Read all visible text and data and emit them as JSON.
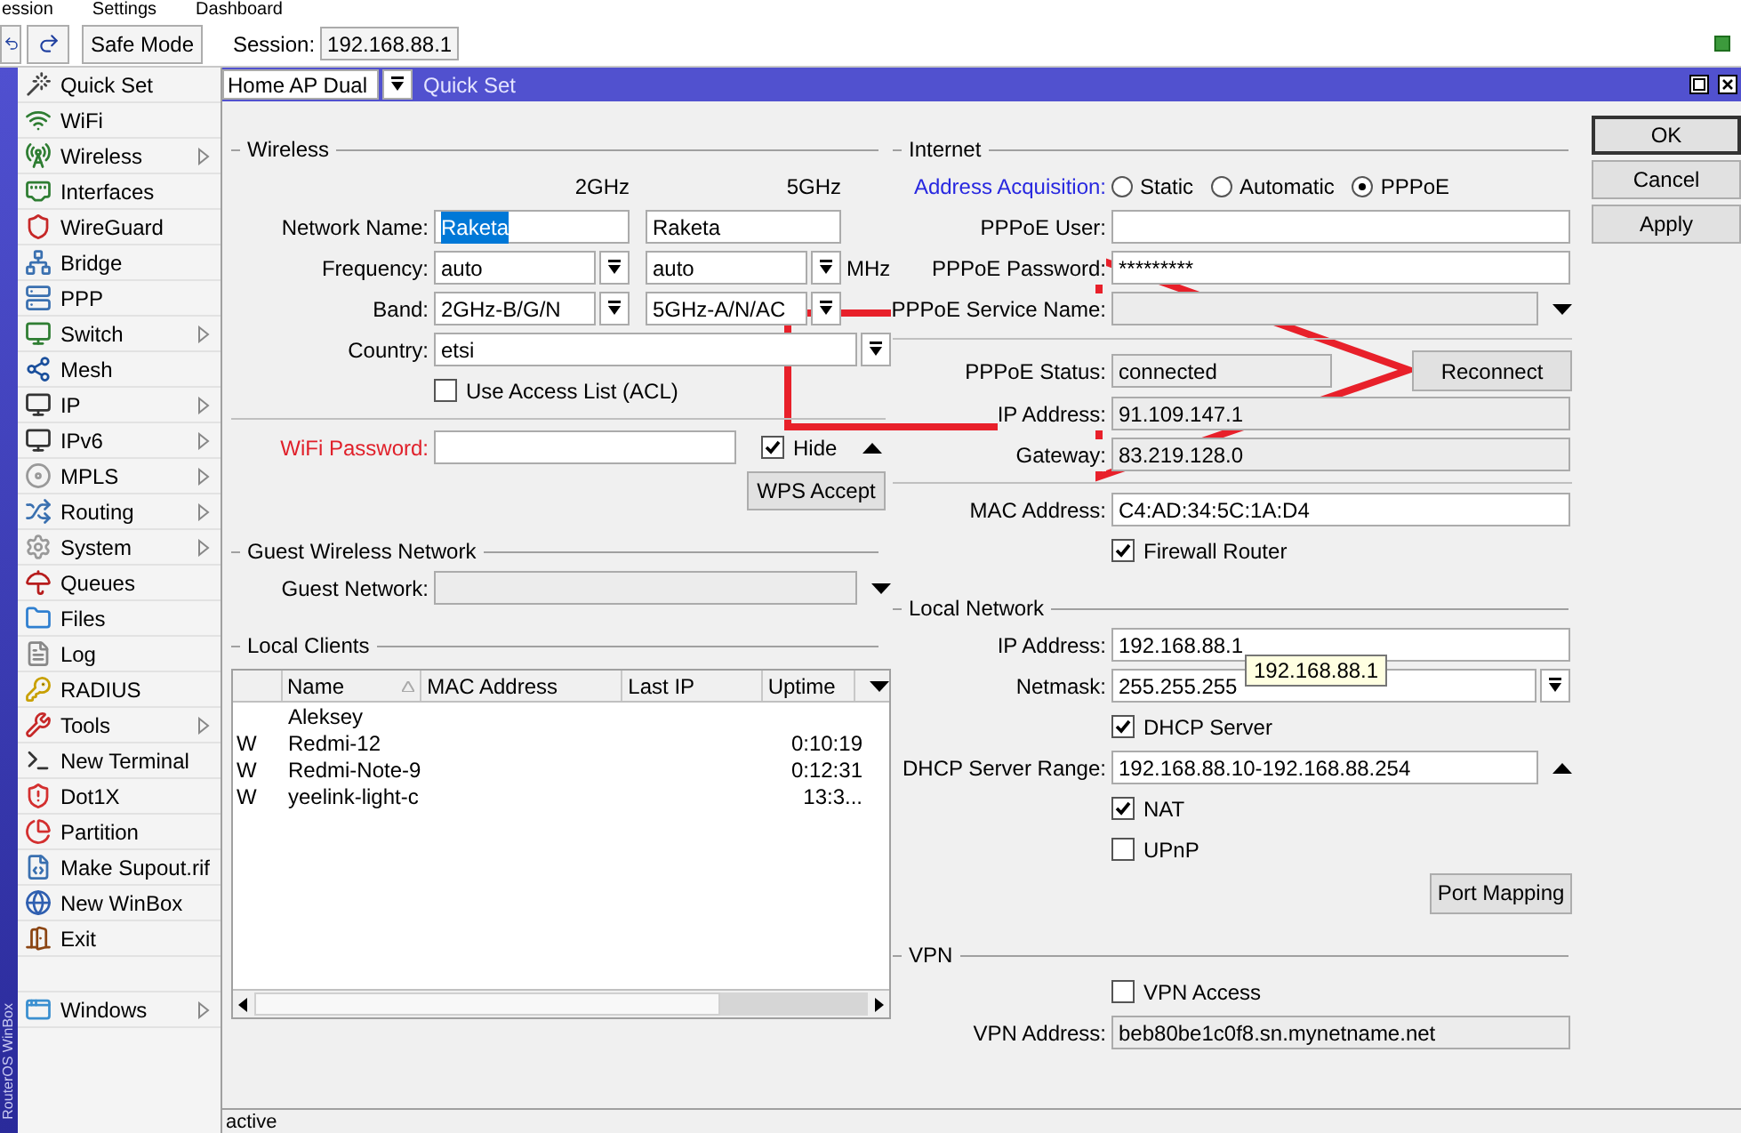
{
  "menu_bar": [
    "ession",
    "Settings",
    "Dashboard"
  ],
  "toolbar": {
    "safe_mode": "Safe Mode",
    "session_label": "Session:",
    "session_value": "192.168.88.1"
  },
  "brand": "RouterOS WinBox",
  "sidebar": {
    "items": [
      {
        "label": "Quick Set",
        "submenu": false
      },
      {
        "label": "WiFi",
        "submenu": false
      },
      {
        "label": "Wireless",
        "submenu": true
      },
      {
        "label": "Interfaces",
        "submenu": false
      },
      {
        "label": "WireGuard",
        "submenu": false
      },
      {
        "label": "Bridge",
        "submenu": false
      },
      {
        "label": "PPP",
        "submenu": false
      },
      {
        "label": "Switch",
        "submenu": true
      },
      {
        "label": "Mesh",
        "submenu": false
      },
      {
        "label": "IP",
        "submenu": true
      },
      {
        "label": "IPv6",
        "submenu": true
      },
      {
        "label": "MPLS",
        "submenu": true
      },
      {
        "label": "Routing",
        "submenu": true
      },
      {
        "label": "System",
        "submenu": true
      },
      {
        "label": "Queues",
        "submenu": false
      },
      {
        "label": "Files",
        "submenu": false
      },
      {
        "label": "Log",
        "submenu": false
      },
      {
        "label": "RADIUS",
        "submenu": false
      },
      {
        "label": "Tools",
        "submenu": true
      },
      {
        "label": "New Terminal",
        "submenu": false
      },
      {
        "label": "Dot1X",
        "submenu": false
      },
      {
        "label": "Partition",
        "submenu": false
      },
      {
        "label": "Make Supout.rif",
        "submenu": false
      },
      {
        "label": "New WinBox",
        "submenu": false
      },
      {
        "label": "Exit",
        "submenu": false
      }
    ],
    "footer_items": [
      {
        "label": "Windows",
        "submenu": true
      }
    ]
  },
  "window": {
    "mode": "Home AP Dual",
    "title": "Quick Set"
  },
  "wireless": {
    "title": "Wireless",
    "band_headers": [
      "2GHz",
      "5GHz"
    ],
    "network_name": {
      "label": "Network Name:",
      "values": [
        {
          "value": "Raketa",
          "highlighted": true
        },
        {
          "value": "Raketa",
          "highlighted": false
        }
      ]
    },
    "frequency": {
      "label": "Frequency:",
      "values": [
        "auto",
        "auto"
      ],
      "unit": "MHz"
    },
    "band": {
      "label": "Band:",
      "values": [
        "2GHz-B/G/N",
        "5GHz-A/N/AC"
      ]
    },
    "country": {
      "label": "Country:",
      "value": "etsi"
    },
    "acl": {
      "label": "Use Access List (ACL)",
      "checked": false
    },
    "wifi_password": {
      "label": "WiFi Password:"
    },
    "hide": {
      "label": "Hide",
      "checked": true
    },
    "wps": "WPS Accept"
  },
  "guest": {
    "title": "Guest Wireless Network",
    "label": "Guest Network:"
  },
  "local_clients": {
    "title": "Local Clients",
    "columns": [
      "Name",
      "MAC Address",
      "Last IP",
      "Uptime"
    ],
    "rows": [
      {
        "name": "Aleksey"
      },
      {
        "flag": "W",
        "name": "Redmi-12",
        "uptime": "0:10:19"
      },
      {
        "flag": "W",
        "name": "Redmi-Note-9",
        "uptime": "0:12:31"
      },
      {
        "flag": "W",
        "name": "yeelink-light-c",
        "uptime": "13:3..."
      }
    ]
  },
  "internet": {
    "title": "Internet",
    "address_acquisition": {
      "label": "Address Acquisition:",
      "options": [
        {
          "label": "Static",
          "selected": false
        },
        {
          "label": "Automatic",
          "selected": false
        },
        {
          "label": "PPPoE",
          "selected": true
        }
      ]
    },
    "pppoe_user": {
      "label": "PPPoE User:"
    },
    "pppoe_password": {
      "label": "PPPoE Password:",
      "value": "*********"
    },
    "service_name": {
      "label": "PPPoE Service Name:"
    },
    "status": {
      "label": "PPPoE Status:",
      "value": "connected"
    },
    "reconnect": "Reconnect",
    "ip": {
      "label": "IP Address:",
      "value": "91.109.147.1"
    },
    "gateway": {
      "label": "Gateway:",
      "value": "83.219.128.0"
    },
    "mac": {
      "label": "MAC Address:",
      "value": "C4:AD:34:5C:1A:D4"
    },
    "firewall": {
      "label": "Firewall Router",
      "checked": true
    }
  },
  "local_network": {
    "title": "Local Network",
    "ip": {
      "label": "IP Address:",
      "value": "192.168.88.1"
    },
    "netmask": {
      "label": "Netmask:",
      "value": "255.255.255"
    },
    "dhcp": {
      "label": "DHCP Server",
      "checked": true
    },
    "range": {
      "label": "DHCP Server Range:",
      "value": "192.168.88.10-192.168.88.254"
    },
    "nat": {
      "label": "NAT",
      "checked": true
    },
    "upnp": {
      "label": "UPnP",
      "checked": false
    },
    "port_mapping": "Port Mapping",
    "tooltip": "192.168.88.1"
  },
  "vpn": {
    "title": "VPN",
    "access": {
      "label": "VPN Access",
      "checked": false
    },
    "address": {
      "label": "VPN Address:",
      "value": "beb80be1c0f8.sn.mynetname.net"
    }
  },
  "buttons": [
    "OK",
    "Cancel",
    "Apply"
  ],
  "status_bar": "active"
}
